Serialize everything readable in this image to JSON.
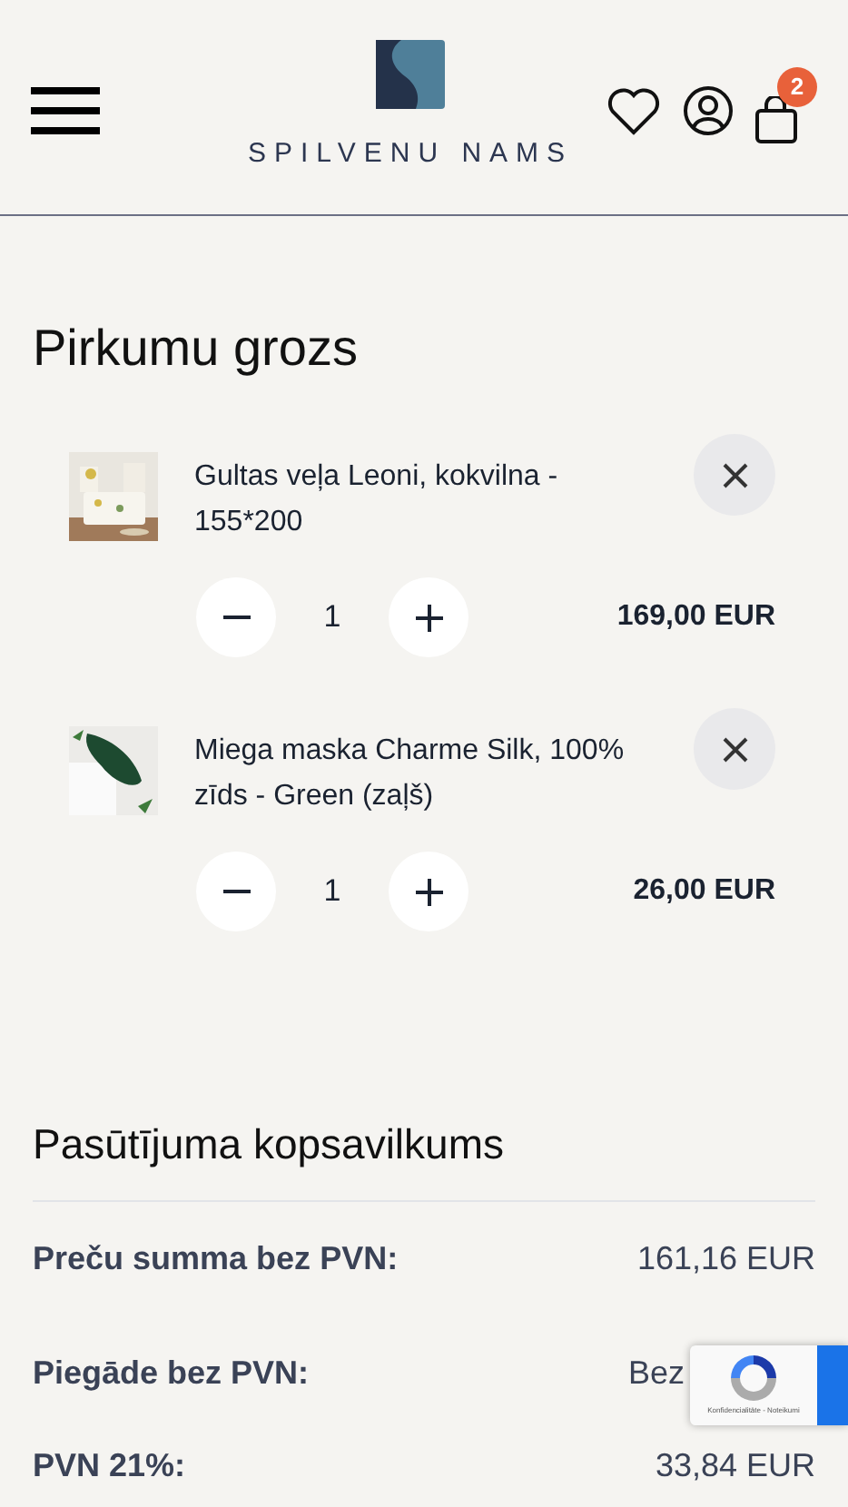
{
  "header": {
    "logo_text": "SPILVENU NAMS",
    "cart_count": "2"
  },
  "cart": {
    "title": "Pirkumu grozs",
    "items": [
      {
        "name": "Gultas veļa Leoni, kokvilna - 155*200",
        "quantity": "1",
        "price": "169,00 EUR"
      },
      {
        "name": "Miega maska Charme Silk, 100% zīds - Green (zaļš)",
        "quantity": "1",
        "price": "26,00 EUR"
      }
    ]
  },
  "summary": {
    "title": "Pasūtījuma kopsavilkums",
    "rows": [
      {
        "label": "Preču summa bez PVN:",
        "value": "161,16 EUR"
      },
      {
        "label": "Piegāde bez PVN:",
        "value": "Bez"
      },
      {
        "label": "PVN 21%:",
        "value": "33,84 EUR"
      }
    ]
  },
  "recaptcha": {
    "links": "Konfidencialitāte - Noteikumi"
  }
}
